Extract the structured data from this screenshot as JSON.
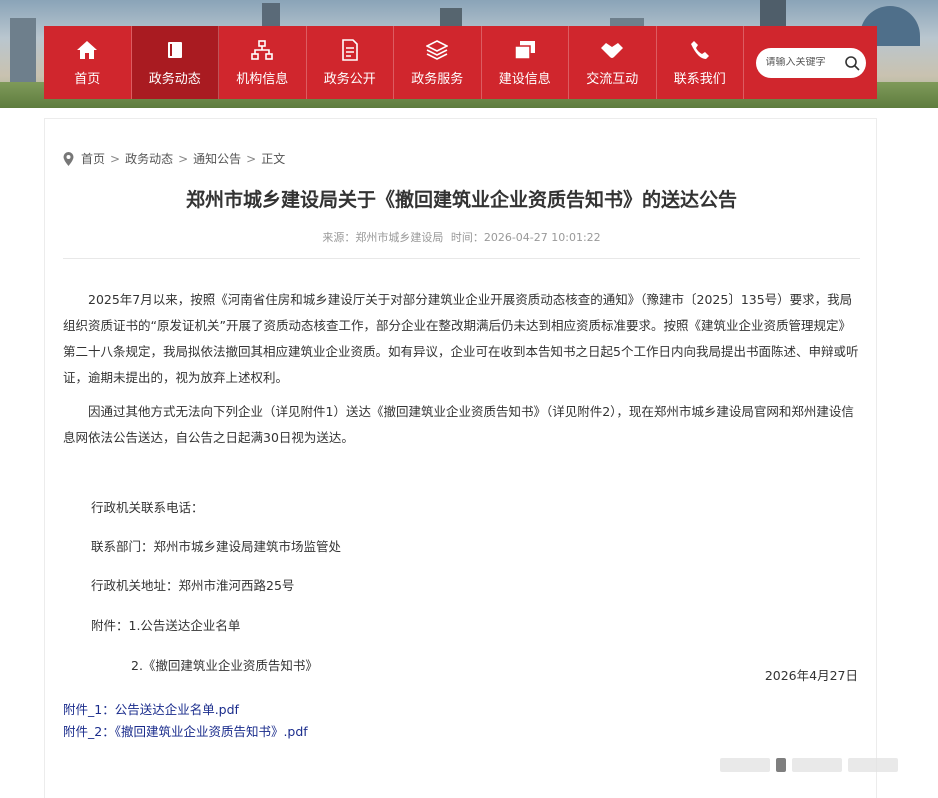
{
  "nav": {
    "items": [
      {
        "label": "首页",
        "icon": "home-icon"
      },
      {
        "label": "政务动态",
        "icon": "book-icon"
      },
      {
        "label": "机构信息",
        "icon": "org-chart-icon"
      },
      {
        "label": "政务公开",
        "icon": "document-icon"
      },
      {
        "label": "政务服务",
        "icon": "layers-icon"
      },
      {
        "label": "建设信息",
        "icon": "copy-icon"
      },
      {
        "label": "交流互动",
        "icon": "handshake-icon"
      },
      {
        "label": "联系我们",
        "icon": "phone-icon"
      }
    ],
    "active_index": 1,
    "search_placeholder": "请输入关键字",
    "colors": {
      "bar": "#d0262d",
      "active": "#a91b21"
    }
  },
  "breadcrumb": {
    "items": [
      "首页",
      "政务动态",
      "通知公告",
      "正文"
    ],
    "separator": ">"
  },
  "article": {
    "title": "郑州市城乡建设局关于《撤回建筑业企业资质告知书》的送达公告",
    "source_label": "来源：郑州市城乡建设局",
    "time_label": "时间：2026-04-27 10:01:22",
    "paragraph1": "2025年7月以来，按照《河南省住房和城乡建设厅关于对部分建筑业企业开展资质动态核查的通知》（豫建市〔2025〕135号）要求，我局组织资质证书的“原发证机关”开展了资质动态核查工作，部分企业在整改期满后仍未达到相应资质标准要求。按照《建筑业企业资质管理规定》第二十八条规定，我局拟依法撤回其相应建筑业企业资质。如有异议，企业可在收到本告知书之日起5个工作日内向我局提出书面陈述、申辩或听证，逾期未提出的，视为放弃上述权利。",
    "paragraph2": "因通过其他方式无法向下列企业（详见附件1）送达《撤回建筑业企业资质告知书》（详见附件2），现在郑州市城乡建设局官网和郑州建设信息网依法公告送达，自公告之日起满30日视为送达。",
    "contact_phone": "行政机关联系电话：",
    "contact_dept": "联系部门：郑州市城乡建设局建筑市场监管处",
    "address": "行政机关地址：郑州市淮河西路25号",
    "attachment_line1": "附件：1.公告送达企业名单",
    "attachment_line2": "2.《撤回建筑业企业资质告知书》",
    "date": "2026年4月27日"
  },
  "attachments": [
    {
      "label": "附件_1：公告送达企业名单.pdf"
    },
    {
      "label": "附件_2：《撤回建筑业企业资质告知书》.pdf"
    }
  ]
}
